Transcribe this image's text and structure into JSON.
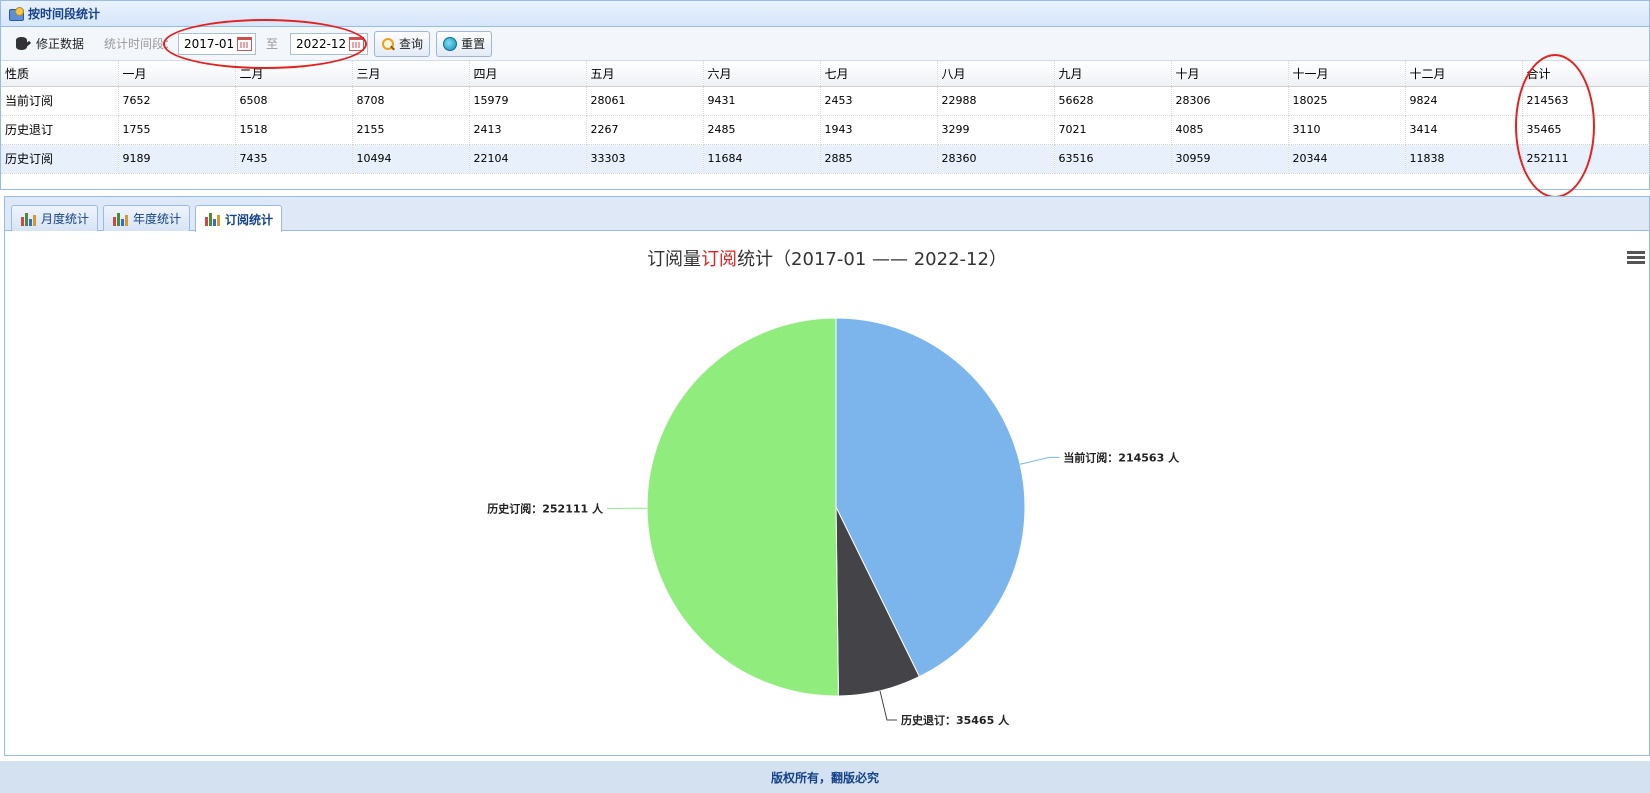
{
  "panel": {
    "title": "按时间段统计"
  },
  "toolbar": {
    "fix_label": "修正数据",
    "range_label": "统计时间段：",
    "start_value": "2017-01",
    "sep_label": "至",
    "end_value": "2022-12",
    "query_label": "查询",
    "reset_label": "重置"
  },
  "table": {
    "headers": [
      "性质",
      "一月",
      "二月",
      "三月",
      "四月",
      "五月",
      "六月",
      "七月",
      "八月",
      "九月",
      "十月",
      "十一月",
      "十二月",
      "合计"
    ],
    "rows": [
      [
        "当前订阅",
        "7652",
        "6508",
        "8708",
        "15979",
        "28061",
        "9431",
        "2453",
        "22988",
        "56628",
        "28306",
        "18025",
        "9824",
        "214563"
      ],
      [
        "历史退订",
        "1755",
        "1518",
        "2155",
        "2413",
        "2267",
        "2485",
        "1943",
        "3299",
        "7021",
        "4085",
        "3110",
        "3414",
        "35465"
      ],
      [
        "历史订阅",
        "9189",
        "7435",
        "10494",
        "22104",
        "33303",
        "11684",
        "2885",
        "28360",
        "63516",
        "30959",
        "20344",
        "11838",
        "252111"
      ]
    ]
  },
  "tabs": [
    {
      "label": "月度统计"
    },
    {
      "label": "年度统计"
    },
    {
      "label": "订阅统计"
    }
  ],
  "chart_data": {
    "type": "pie",
    "title_prefix": "订阅量",
    "title_highlight": "订阅",
    "title_suffix": "统计（2017-01 —— 2022-12）",
    "unit": "人",
    "slices": [
      {
        "name": "当前订阅",
        "value": 214563,
        "color": "#7cb5ec"
      },
      {
        "name": "历史退订",
        "value": 35465,
        "color": "#434348"
      },
      {
        "name": "历史订阅",
        "value": 252111,
        "color": "#90ed7d"
      }
    ]
  },
  "footer": {
    "text": "版权所有，翻版必究"
  }
}
